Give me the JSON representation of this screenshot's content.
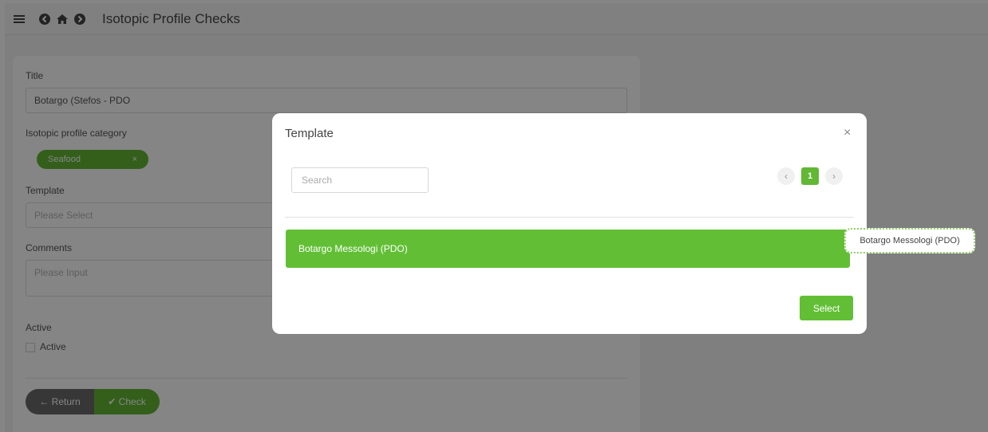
{
  "header": {
    "title": "Isotopic Profile Checks"
  },
  "form": {
    "title_label": "Title",
    "title_value": "Botargo (Stefos - PDO",
    "category_label": "Isotopic profile category",
    "category_tag": "Seafood",
    "category_tag_remove": "×",
    "template_label": "Template",
    "template_placeholder": "Please Select",
    "comments_label": "Comments",
    "comments_placeholder": "Please Input",
    "active_label": "Active",
    "active_checkbox_label": "Active",
    "return_label": "← Return",
    "check_label": "✔ Check"
  },
  "modal": {
    "title": "Template",
    "close": "×",
    "search_placeholder": "Search",
    "pager": {
      "prev": "‹",
      "current_page": "1",
      "next": "›"
    },
    "rows": [
      {
        "label": "Botargo Messologi (PDO)",
        "selected": true
      }
    ],
    "select_label": "Select"
  },
  "tooltip": {
    "text": "Botargo Messologi (PDO)"
  },
  "colors": {
    "accent_green": "#62bf35",
    "tag_green": "#62b735",
    "return_gray": "#6a6a6a"
  },
  "icons": [
    "menu-icon",
    "back-circle-icon",
    "home-icon",
    "forward-circle-icon"
  ]
}
